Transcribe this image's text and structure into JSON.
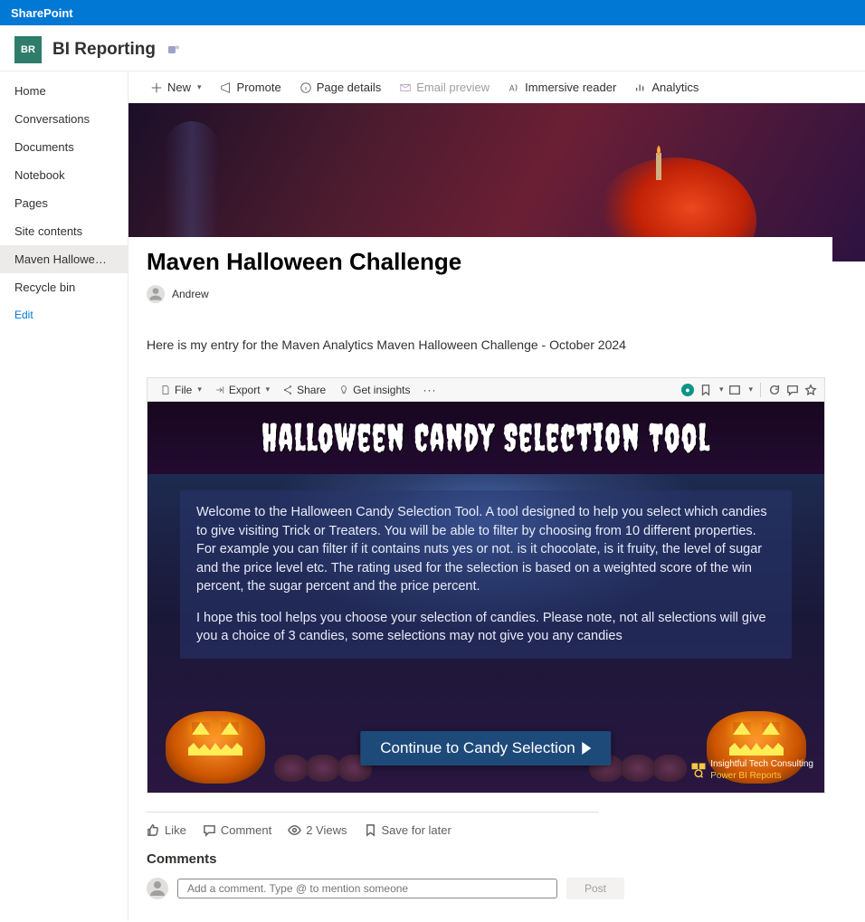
{
  "suitebar": {
    "product": "SharePoint"
  },
  "site": {
    "logo_initials": "BR",
    "title": "BI Reporting"
  },
  "leftnav": {
    "items": [
      {
        "label": "Home"
      },
      {
        "label": "Conversations"
      },
      {
        "label": "Documents"
      },
      {
        "label": "Notebook"
      },
      {
        "label": "Pages"
      },
      {
        "label": "Site contents"
      },
      {
        "label": "Maven Halloween Challe…",
        "active": true
      },
      {
        "label": "Recycle bin"
      }
    ],
    "edit_label": "Edit"
  },
  "cmdbar": {
    "new": "New",
    "promote": "Promote",
    "page_details": "Page details",
    "email_preview": "Email preview",
    "immersive": "Immersive reader",
    "analytics": "Analytics"
  },
  "page": {
    "title": "Maven Halloween Challenge",
    "author": "Andrew",
    "intro": "Here is my entry for the Maven Analytics Maven Halloween Challenge - October 2024"
  },
  "pbi": {
    "toolbar": {
      "file": "File",
      "export": "Export",
      "share": "Share",
      "insights": "Get insights"
    },
    "title": "Halloween Candy Selection Tool",
    "para1": "Welcome to the Halloween Candy Selection Tool. A tool designed to help you select which candies to give visiting Trick or Treaters. You will be able to filter by choosing from 10 different  properties. For example you can filter if it contains nuts yes or not. is it chocolate, is it fruity, the level of sugar and the price level etc. The rating used for the selection is based on a weighted score of the win percent, the sugar percent and the price percent.",
    "para2": "I hope this tool helps you choose your selection of candies. Please note, not all selections will give you a choice of 3 candies, some selections may not give you any candies",
    "continue": "Continue to Candy Selection",
    "brand_line1": "Insightful Tech Consulting",
    "brand_line2": "Power BI Reports"
  },
  "social": {
    "like": "Like",
    "comment": "Comment",
    "views": "2 Views",
    "save": "Save for later"
  },
  "comments": {
    "header": "Comments",
    "placeholder": "Add a comment. Type @ to mention someone",
    "post": "Post"
  }
}
